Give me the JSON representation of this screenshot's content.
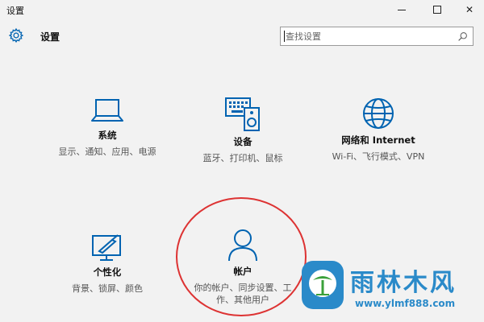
{
  "window": {
    "title": "设置",
    "minimize_label": "",
    "maximize_label": "",
    "close_label": "✕"
  },
  "header": {
    "title": "设置",
    "search_placeholder": "查找设置"
  },
  "tiles": [
    {
      "title": "系统",
      "desc": "显示、通知、应用、电源"
    },
    {
      "title": "设备",
      "desc": "蓝牙、打印机、鼠标"
    },
    {
      "title": "网络和 Internet",
      "desc": "Wi-Fi、飞行模式、VPN"
    },
    {
      "title": "个性化",
      "desc": "背景、锁屏、颜色"
    },
    {
      "title": "帐户",
      "desc": "你的帐户、同步设置、工作、其他用户"
    }
  ],
  "watermark": {
    "brand": "雨林木风",
    "url": "www.ylmf888.com"
  },
  "colors": {
    "accent": "#0063b1",
    "highlight_circle": "#dd3333",
    "watermark": "#2a8ac9"
  }
}
